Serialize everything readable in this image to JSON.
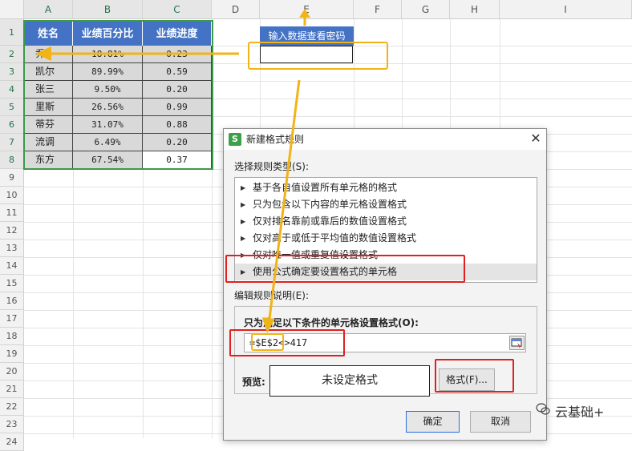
{
  "spreadsheet": {
    "columns": [
      "A",
      "B",
      "C",
      "D",
      "E",
      "F",
      "G",
      "H",
      "I"
    ],
    "rows": [
      "1",
      "2",
      "3",
      "4",
      "5",
      "6",
      "7",
      "8",
      "9",
      "10",
      "11",
      "12",
      "13",
      "14",
      "15",
      "16",
      "17",
      "18",
      "19",
      "20",
      "21",
      "22",
      "23",
      "24"
    ],
    "table": {
      "headers": [
        "姓名",
        "业绩百分比",
        "业绩进度"
      ],
      "rows": [
        {
          "name": "乔",
          "pct": "18.81%",
          "prog": "0.23"
        },
        {
          "name": "凯尔",
          "pct": "89.99%",
          "prog": "0.59"
        },
        {
          "name": "张三",
          "pct": "9.50%",
          "prog": "0.20"
        },
        {
          "name": "里斯",
          "pct": "26.56%",
          "prog": "0.99"
        },
        {
          "name": "蒂芬",
          "pct": "31.07%",
          "prog": "0.88"
        },
        {
          "name": "流调",
          "pct": "6.49%",
          "prog": "0.20"
        },
        {
          "name": "东方",
          "pct": "67.54%",
          "prog": "0.37"
        }
      ]
    },
    "password_header": "输入数据查看密码",
    "password_value": ""
  },
  "dialog": {
    "title": "新建格式规则",
    "close_glyph": "✕",
    "logo_letter": "S",
    "select_type_label": "选择规则类型(S):",
    "rule_types": [
      "基于各自值设置所有单元格的格式",
      "只为包含以下内容的单元格设置格式",
      "仅对排名靠前或靠后的数值设置格式",
      "仅对高于或低于平均值的数值设置格式",
      "仅对唯一值或重复值设置格式",
      "使用公式确定要设置格式的单元格"
    ],
    "edit_desc_label": "编辑规则说明(E):",
    "formula_label": "只为满足以下条件的单元格设置格式(O):",
    "formula_value": "=$E$2<>417",
    "preview_label": "预览:",
    "preview_text": "未设定格式",
    "format_button": "格式(F)...",
    "ok_button": "确定",
    "cancel_button": "取消"
  },
  "watermark": "云基础+",
  "colors": {
    "header_blue": "#4472c4",
    "selection_green": "#3c9a4a",
    "highlight_red": "#e02020",
    "annotation_yellow": "#f2b316"
  }
}
